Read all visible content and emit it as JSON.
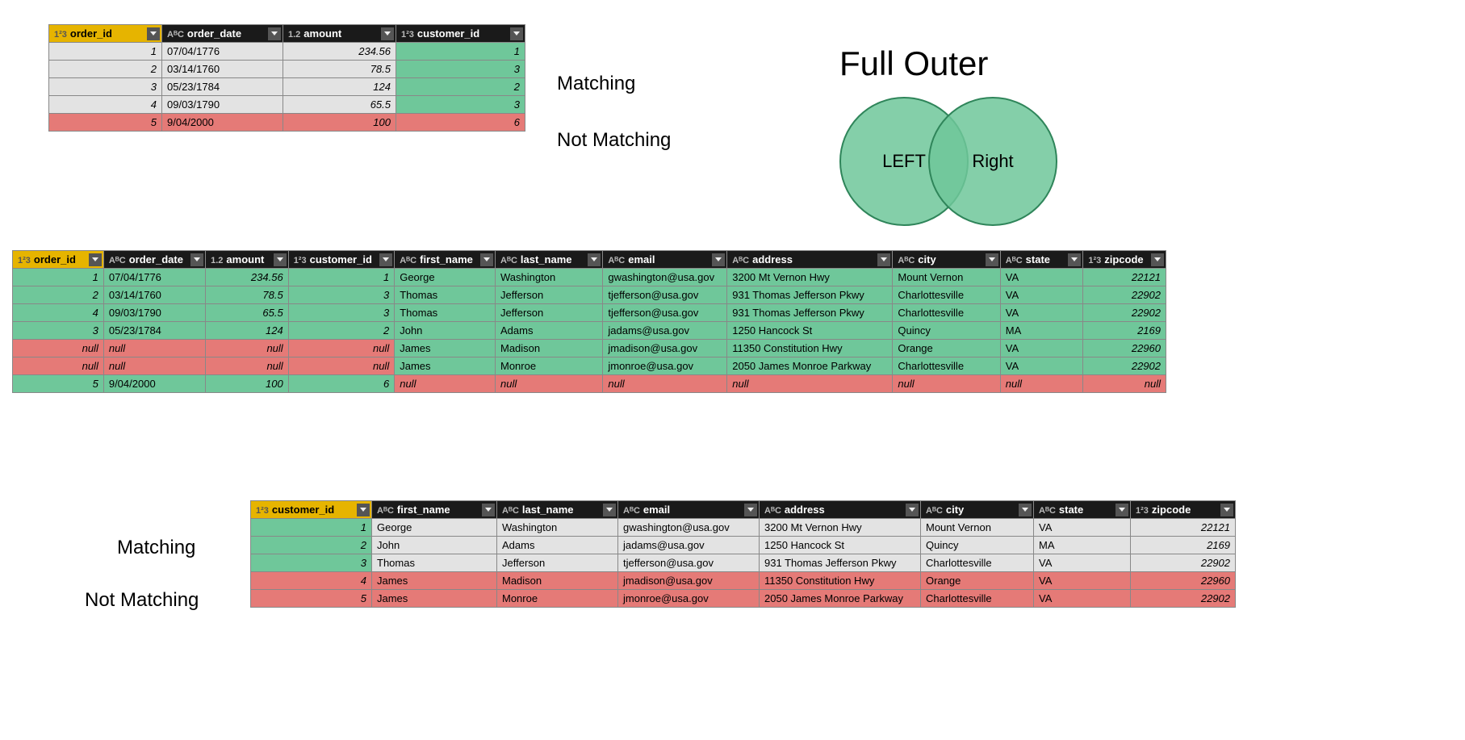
{
  "diagram_title": "Full Outer",
  "venn": {
    "left": "LEFT",
    "right": "Right"
  },
  "labels": {
    "matching_top": "Matching",
    "notmatching_top": "Not Matching",
    "matching_bot": "Matching",
    "notmatching_bot": "Not Matching"
  },
  "type_prefixes": {
    "int": "1²3",
    "text": "AᴮC",
    "decimal": "1.2"
  },
  "orders": {
    "headers": [
      {
        "prefix": "int",
        "label": "order_id",
        "primary": true
      },
      {
        "prefix": "text",
        "label": "order_date"
      },
      {
        "prefix": "decimal",
        "label": "amount"
      },
      {
        "prefix": "int",
        "label": "customer_id"
      }
    ],
    "rows": [
      {
        "match": true,
        "cells": [
          "1",
          "07/04/1776",
          "234.56",
          "1"
        ]
      },
      {
        "match": true,
        "cells": [
          "2",
          "03/14/1760",
          "78.5",
          "3"
        ]
      },
      {
        "match": true,
        "cells": [
          "3",
          "05/23/1784",
          "124",
          "2"
        ]
      },
      {
        "match": true,
        "cells": [
          "4",
          "09/03/1790",
          "65.5",
          "3"
        ]
      },
      {
        "match": false,
        "cells": [
          "5",
          "9/04/2000",
          "100",
          "6"
        ]
      }
    ]
  },
  "result": {
    "headers": [
      {
        "prefix": "int",
        "label": "order_id",
        "primary": true
      },
      {
        "prefix": "text",
        "label": "order_date"
      },
      {
        "prefix": "decimal",
        "label": "amount"
      },
      {
        "prefix": "int",
        "label": "customer_id"
      },
      {
        "prefix": "text",
        "label": "first_name"
      },
      {
        "prefix": "text",
        "label": "last_name"
      },
      {
        "prefix": "text",
        "label": "email"
      },
      {
        "prefix": "text",
        "label": "address"
      },
      {
        "prefix": "text",
        "label": "city"
      },
      {
        "prefix": "text",
        "label": "state"
      },
      {
        "prefix": "int",
        "label": "zipcode"
      }
    ],
    "rows": [
      {
        "left": "green",
        "right": "green",
        "cells": [
          "1",
          "07/04/1776",
          "234.56",
          "1",
          "George",
          "Washington",
          "gwashington@usa.gov",
          "3200 Mt Vernon Hwy",
          "Mount Vernon",
          "VA",
          "22121"
        ]
      },
      {
        "left": "green",
        "right": "green",
        "cells": [
          "2",
          "03/14/1760",
          "78.5",
          "3",
          "Thomas",
          "Jefferson",
          "tjefferson@usa.gov",
          "931 Thomas Jefferson Pkwy",
          "Charlottesville",
          "VA",
          "22902"
        ]
      },
      {
        "left": "green",
        "right": "green",
        "cells": [
          "4",
          "09/03/1790",
          "65.5",
          "3",
          "Thomas",
          "Jefferson",
          "tjefferson@usa.gov",
          "931 Thomas Jefferson Pkwy",
          "Charlottesville",
          "VA",
          "22902"
        ]
      },
      {
        "left": "green",
        "right": "green",
        "cells": [
          "3",
          "05/23/1784",
          "124",
          "2",
          "John",
          "Adams",
          "jadams@usa.gov",
          "1250 Hancock St",
          "Quincy",
          "MA",
          "2169"
        ]
      },
      {
        "left": "red",
        "right": "green",
        "cells": [
          "null",
          "null",
          "null",
          "null",
          "James",
          "Madison",
          "jmadison@usa.gov",
          "11350 Constitution Hwy",
          "Orange",
          "VA",
          "22960"
        ]
      },
      {
        "left": "red",
        "right": "green",
        "cells": [
          "null",
          "null",
          "null",
          "null",
          "James",
          "Monroe",
          "jmonroe@usa.gov",
          "2050 James Monroe Parkway",
          "Charlottesville",
          "VA",
          "22902"
        ]
      },
      {
        "left": "green",
        "right": "red",
        "cells": [
          "5",
          "9/04/2000",
          "100",
          "6",
          "null",
          "null",
          "null",
          "null",
          "null",
          "null",
          "null"
        ]
      }
    ]
  },
  "customers": {
    "headers": [
      {
        "prefix": "int",
        "label": "customer_id",
        "primary": true
      },
      {
        "prefix": "text",
        "label": "first_name"
      },
      {
        "prefix": "text",
        "label": "last_name"
      },
      {
        "prefix": "text",
        "label": "email"
      },
      {
        "prefix": "text",
        "label": "address"
      },
      {
        "prefix": "text",
        "label": "city"
      },
      {
        "prefix": "text",
        "label": "state"
      },
      {
        "prefix": "int",
        "label": "zipcode"
      }
    ],
    "rows": [
      {
        "match": true,
        "cells": [
          "1",
          "George",
          "Washington",
          "gwashington@usa.gov",
          "3200 Mt Vernon Hwy",
          "Mount Vernon",
          "VA",
          "22121"
        ]
      },
      {
        "match": true,
        "cells": [
          "2",
          "John",
          "Adams",
          "jadams@usa.gov",
          "1250 Hancock St",
          "Quincy",
          "MA",
          "2169"
        ]
      },
      {
        "match": true,
        "cells": [
          "3",
          "Thomas",
          "Jefferson",
          "tjefferson@usa.gov",
          "931 Thomas Jefferson Pkwy",
          "Charlottesville",
          "VA",
          "22902"
        ]
      },
      {
        "match": false,
        "cells": [
          "4",
          "James",
          "Madison",
          "jmadison@usa.gov",
          "11350 Constitution Hwy",
          "Orange",
          "VA",
          "22960"
        ]
      },
      {
        "match": false,
        "cells": [
          "5",
          "James",
          "Monroe",
          "jmonroe@usa.gov",
          "2050 James Monroe Parkway",
          "Charlottesville",
          "VA",
          "22902"
        ]
      }
    ]
  }
}
